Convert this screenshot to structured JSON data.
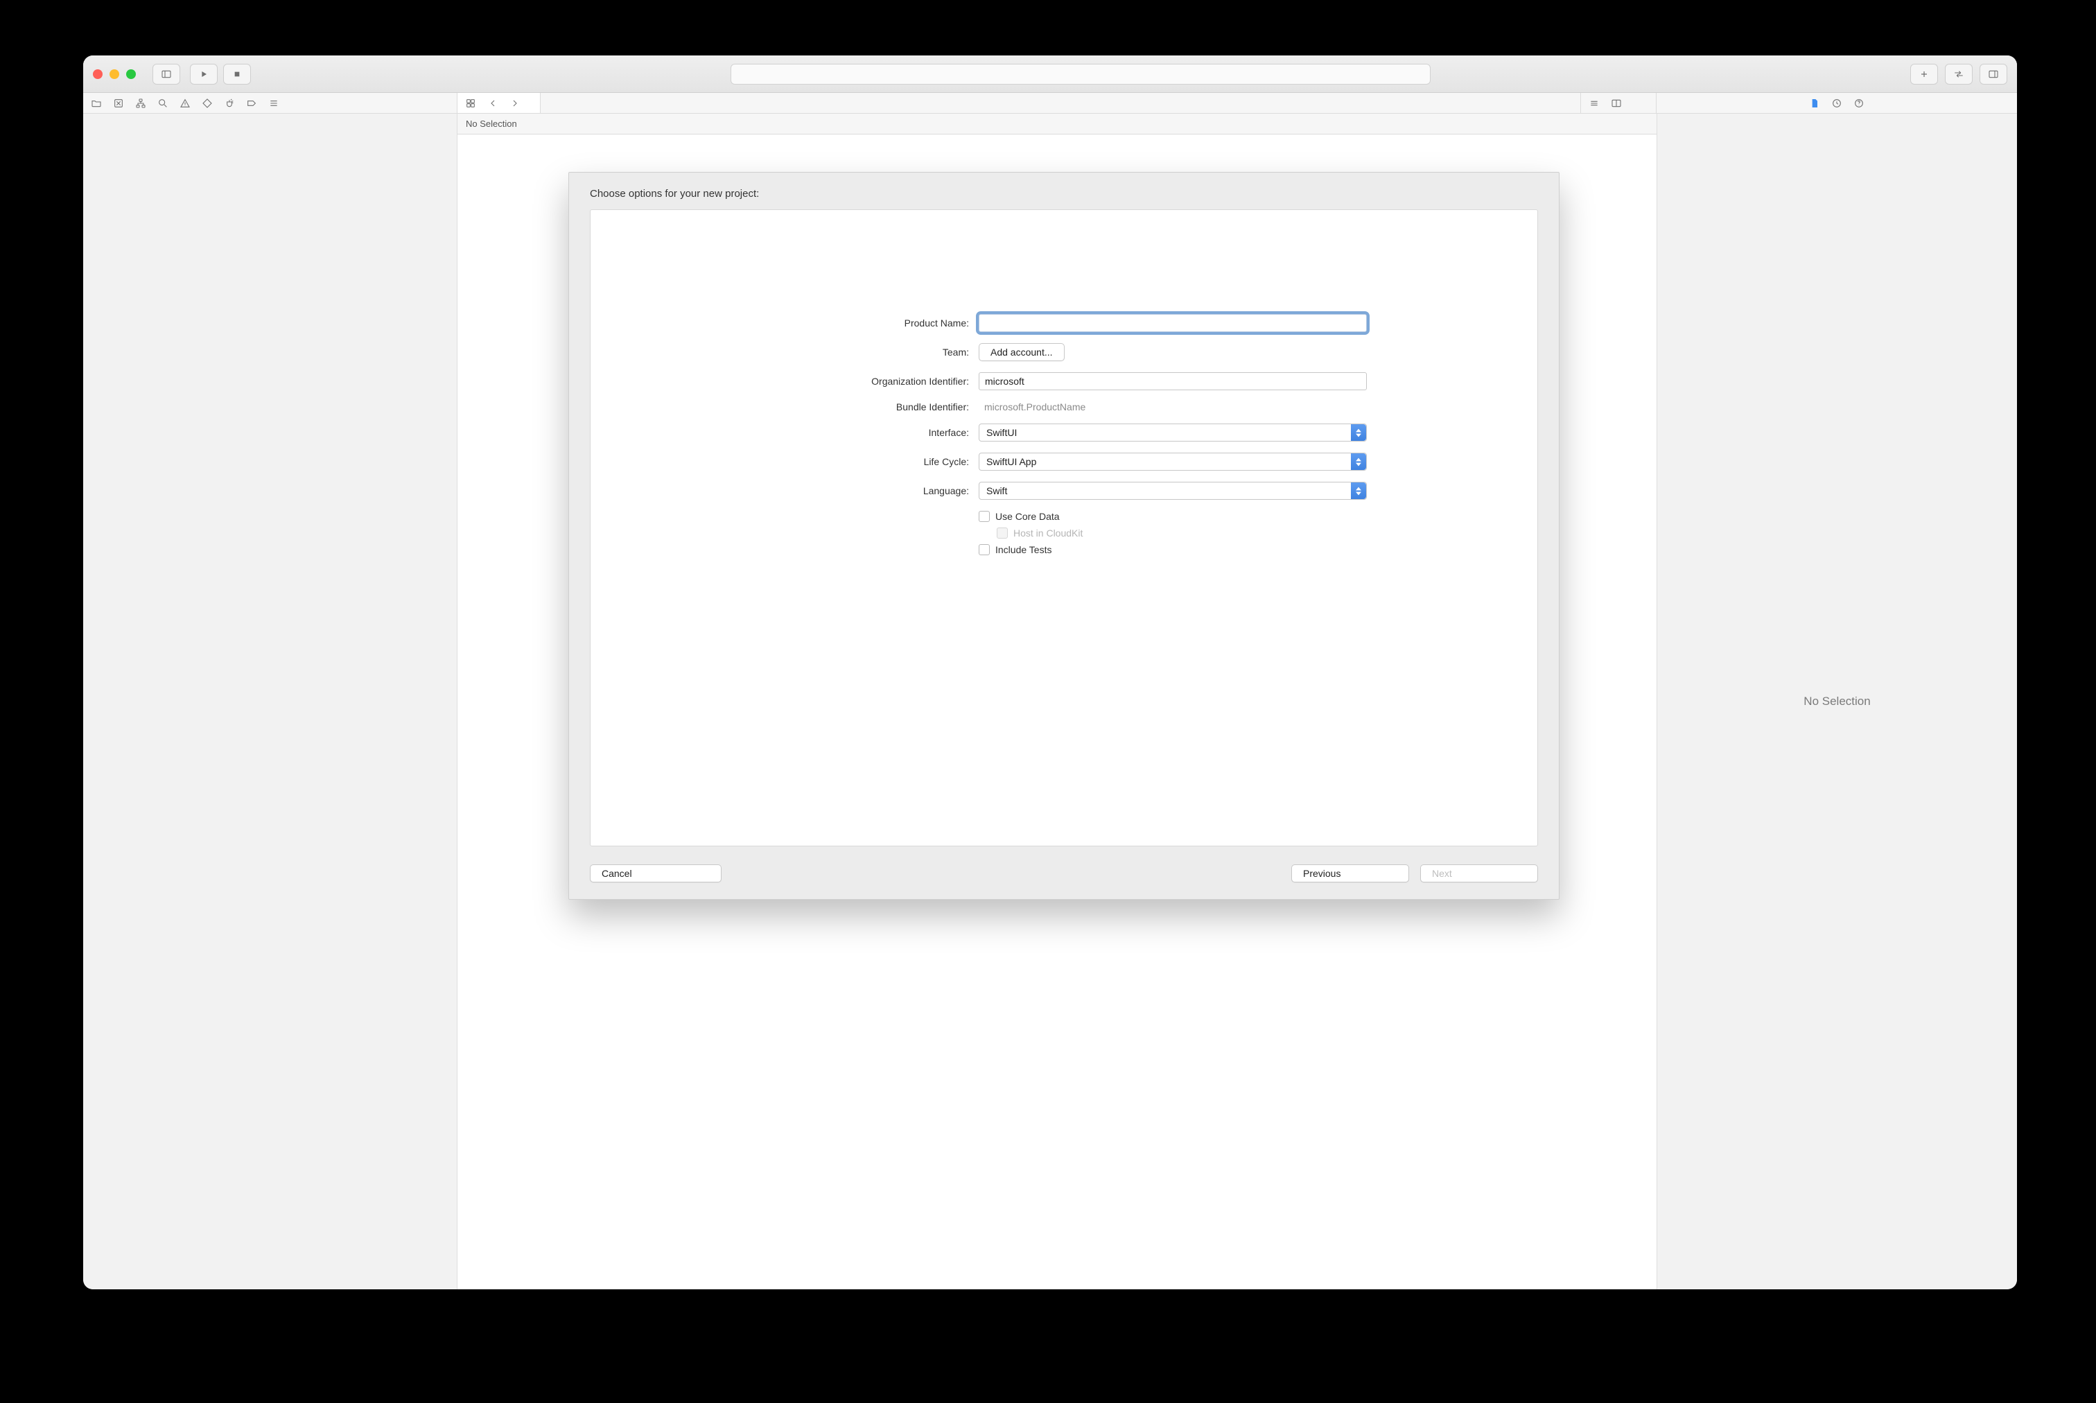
{
  "jumpbar": {
    "text": "No Selection"
  },
  "inspector": {
    "empty": "No Selection"
  },
  "sheet": {
    "title": "Choose options for your new project:",
    "labels": {
      "product_name": "Product Name:",
      "team": "Team:",
      "org_id": "Organization Identifier:",
      "bundle_id": "Bundle Identifier:",
      "interface": "Interface:",
      "lifecycle": "Life Cycle:",
      "language": "Language:"
    },
    "values": {
      "product_name": "",
      "team_button": "Add account...",
      "org_id": "microsoft",
      "bundle_id": "microsoft.ProductName",
      "interface": "SwiftUI",
      "lifecycle": "SwiftUI App",
      "language": "Swift"
    },
    "checks": {
      "core_data": "Use Core Data",
      "cloudkit": "Host in CloudKit",
      "tests": "Include Tests"
    },
    "buttons": {
      "cancel": "Cancel",
      "previous": "Previous",
      "next": "Next"
    }
  }
}
